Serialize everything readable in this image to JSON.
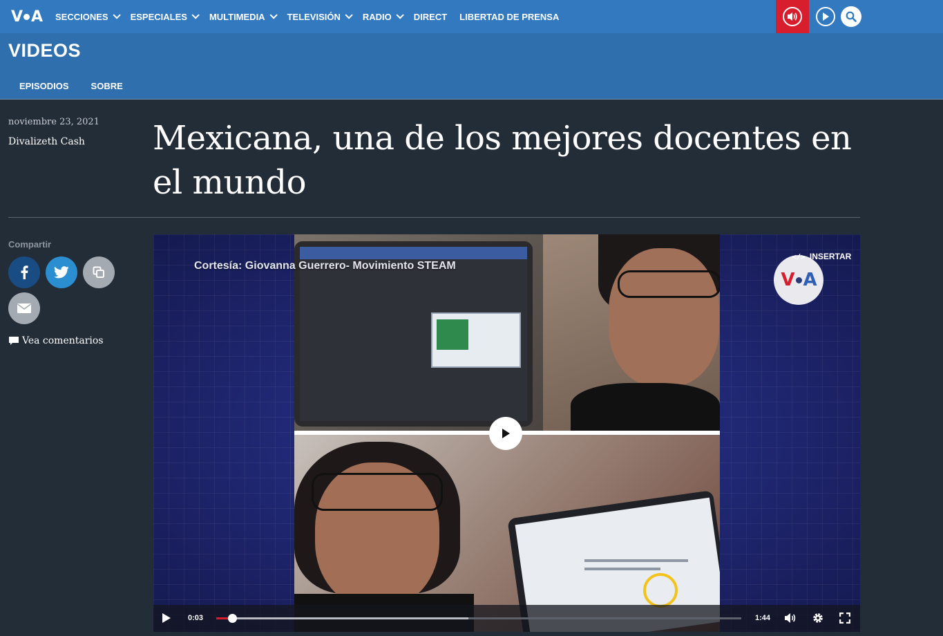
{
  "brand": {
    "logo_text": "VOA"
  },
  "nav": {
    "items": [
      {
        "label": "SECCIONES",
        "dropdown": true
      },
      {
        "label": "ESPECIALES",
        "dropdown": true
      },
      {
        "label": "MULTIMEDIA",
        "dropdown": true
      },
      {
        "label": "TELEVISIÓN",
        "dropdown": true
      },
      {
        "label": "RADIO",
        "dropdown": true
      },
      {
        "label": "DIRECT",
        "dropdown": false
      },
      {
        "label": "LIBERTAD DE PRENSA",
        "dropdown": false
      }
    ],
    "icons": [
      "live-audio-icon",
      "play-circle-icon",
      "search-icon"
    ],
    "live_color": "#d81e2d",
    "bar_color": "#3279bf"
  },
  "section": {
    "title": "VIDEOS",
    "subnav": [
      "EPISODIOS",
      "SOBRE"
    ]
  },
  "article": {
    "date": "noviembre 23, 2021",
    "author": "Divalizeth Cash",
    "title": "Mexicana, una de los mejores docentes en el mundo"
  },
  "share": {
    "label": "Compartir",
    "buttons": [
      "facebook-icon",
      "twitter-icon",
      "copy-link-icon",
      "email-icon"
    ],
    "comments_label": "Vea comentarios"
  },
  "video": {
    "caption": "Cortesía: Giovanna Guerrero- Movimiento STEAM",
    "embed_label": "INSERTAR",
    "embed_code": "</>",
    "watermark": "VOA",
    "current_time": "0:03",
    "duration": "1:44",
    "progress_fraction": 0.03,
    "buffered_fraction": 0.48
  }
}
